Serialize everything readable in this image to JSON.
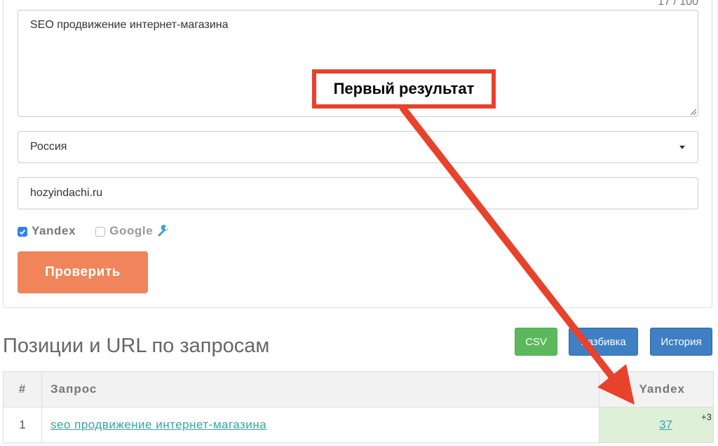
{
  "form": {
    "counter": "17 / 100",
    "query_text": "SEO продвижение интернет-магазина",
    "region": "Россия",
    "site": "hozyindachi.ru",
    "engines": [
      {
        "label": "Yandex",
        "checked": true
      },
      {
        "label": "Google",
        "checked": false
      }
    ],
    "submit_label": "Проверить"
  },
  "results": {
    "title": "Позиции и URL по запросам",
    "buttons": {
      "csv": "CSV",
      "razbivka": "Разбивка",
      "history": "История"
    },
    "columns": [
      "#",
      "Запрос",
      "Yandex"
    ],
    "rows": [
      {
        "num": "1",
        "query": "seo продвижение интернет-магазина",
        "yandex": "37",
        "delta": "+3"
      }
    ]
  },
  "annotation": {
    "label": "Первый результат",
    "color": "#e8412c"
  },
  "colors": {
    "accent": "#f0845a",
    "success": "#5cb85c",
    "primary": "#3f7fc4",
    "link": "#3aa3a3",
    "highlight_cell": "#dff0d8"
  },
  "icons": {
    "checkbox_checked": "checkbox-checked-icon",
    "checkbox_unchecked": "checkbox-unchecked-icon",
    "settings": "wrench-icon",
    "dropdown": "caret-down-icon",
    "resize": "resize-handle-icon"
  }
}
